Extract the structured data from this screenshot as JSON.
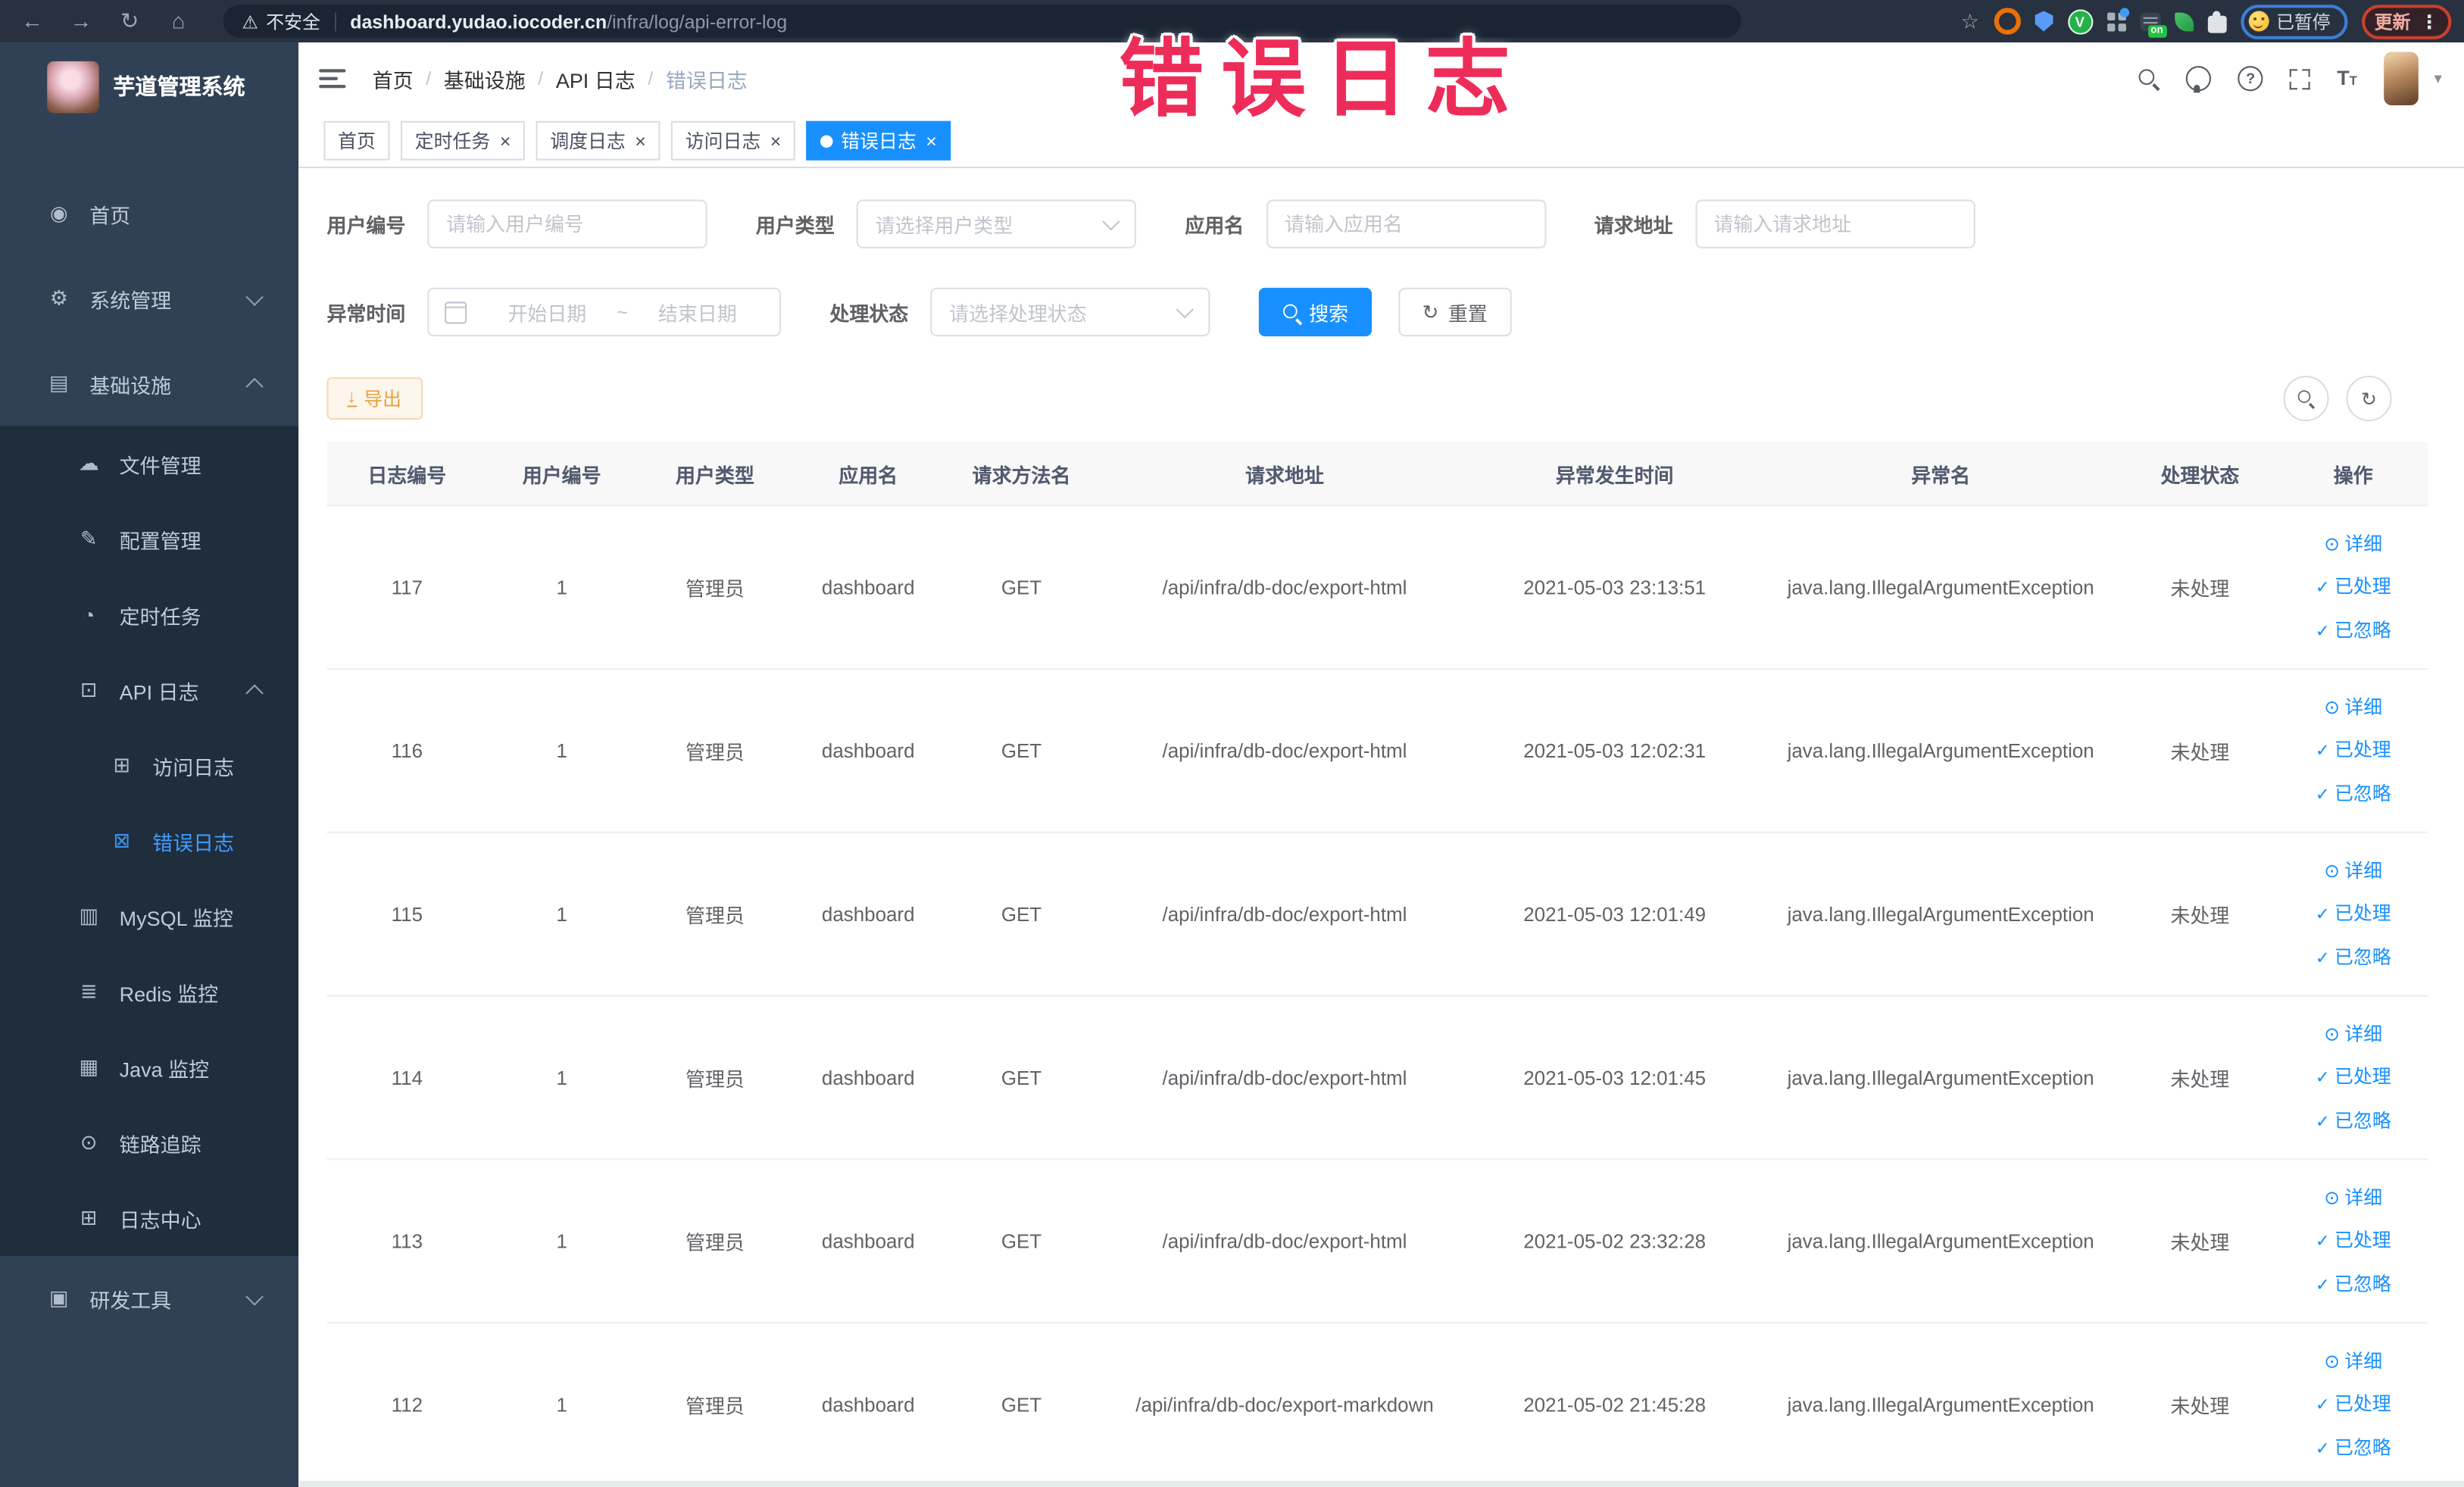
{
  "browser": {
    "security_label": "不安全",
    "url_host": "dashboard.yudao.iocoder.cn",
    "url_path": "/infra/log/api-error-log",
    "paused_label": "已暂停",
    "update_label": "更新"
  },
  "annotation": {
    "text": "错误日志",
    "color": "#ee2c5a"
  },
  "sidebar": {
    "logo_title": "芋道管理系统",
    "items": [
      {
        "id": "home",
        "label": "首页",
        "icon": "dashboard-icon",
        "level": 1
      },
      {
        "id": "system",
        "label": "系统管理",
        "icon": "gear-icon",
        "level": 1,
        "chevron": "down"
      },
      {
        "id": "infra",
        "label": "基础设施",
        "icon": "infra-icon",
        "level": 1,
        "chevron": "up"
      },
      {
        "id": "file",
        "label": "文件管理",
        "icon": "cloud-icon",
        "level": 2
      },
      {
        "id": "config",
        "label": "配置管理",
        "icon": "edit-icon",
        "level": 2
      },
      {
        "id": "job",
        "label": "定时任务",
        "icon": "timer-icon",
        "level": 2
      },
      {
        "id": "api-log",
        "label": "API 日志",
        "icon": "api-log-icon",
        "level": 2,
        "chevron": "up"
      },
      {
        "id": "access-log",
        "label": "访问日志",
        "icon": "access-log-icon",
        "level": 3
      },
      {
        "id": "error-log",
        "label": "错误日志",
        "icon": "error-log-icon",
        "level": 3,
        "active": true
      },
      {
        "id": "mysql",
        "label": "MySQL 监控",
        "icon": "mysql-icon",
        "level": 2
      },
      {
        "id": "redis",
        "label": "Redis 监控",
        "icon": "redis-icon",
        "level": 2
      },
      {
        "id": "java",
        "label": "Java 监控",
        "icon": "java-icon",
        "level": 2
      },
      {
        "id": "trace",
        "label": "链路追踪",
        "icon": "trace-icon",
        "level": 2
      },
      {
        "id": "log-center",
        "label": "日志中心",
        "icon": "log-center-icon",
        "level": 2
      },
      {
        "id": "dev-tools",
        "label": "研发工具",
        "icon": "devtools-icon",
        "level": 1,
        "chevron": "down"
      }
    ]
  },
  "navbar": {
    "breadcrumb": [
      "首页",
      "基础设施",
      "API 日志",
      "错误日志"
    ],
    "breadcrumb_separator": "/"
  },
  "tabs": [
    {
      "label": "首页",
      "closable": false,
      "active": false
    },
    {
      "label": "定时任务",
      "closable": true,
      "active": false
    },
    {
      "label": "调度日志",
      "closable": true,
      "active": false
    },
    {
      "label": "访问日志",
      "closable": true,
      "active": false
    },
    {
      "label": "错误日志",
      "closable": true,
      "active": true
    }
  ],
  "filters": {
    "user_id": {
      "label": "用户编号",
      "placeholder": "请输入用户编号"
    },
    "user_type": {
      "label": "用户类型",
      "placeholder": "请选择用户类型"
    },
    "app_name": {
      "label": "应用名",
      "placeholder": "请输入应用名"
    },
    "request_url": {
      "label": "请求地址",
      "placeholder": "请输入请求地址"
    },
    "exception_time": {
      "label": "异常时间",
      "start_placeholder": "开始日期",
      "separator": "~",
      "end_placeholder": "结束日期"
    },
    "process_status": {
      "label": "处理状态",
      "placeholder": "请选择处理状态"
    },
    "search_label": "搜索",
    "reset_label": "重置"
  },
  "toolbar": {
    "export_label": "导出"
  },
  "table": {
    "columns": [
      "日志编号",
      "用户编号",
      "用户类型",
      "应用名",
      "请求方法名",
      "请求地址",
      "异常发生时间",
      "异常名",
      "处理状态",
      "操作"
    ],
    "action_labels": [
      "详细",
      "已处理",
      "已忽略"
    ],
    "rows": [
      {
        "id": "117",
        "user_id": "1",
        "user_type": "管理员",
        "app": "dashboard",
        "method": "GET",
        "url": "/api/infra/db-doc/export-html",
        "time": "2021-05-03 23:13:51",
        "exception": "java.lang.IllegalArgumentException",
        "status": "未处理"
      },
      {
        "id": "116",
        "user_id": "1",
        "user_type": "管理员",
        "app": "dashboard",
        "method": "GET",
        "url": "/api/infra/db-doc/export-html",
        "time": "2021-05-03 12:02:31",
        "exception": "java.lang.IllegalArgumentException",
        "status": "未处理"
      },
      {
        "id": "115",
        "user_id": "1",
        "user_type": "管理员",
        "app": "dashboard",
        "method": "GET",
        "url": "/api/infra/db-doc/export-html",
        "time": "2021-05-03 12:01:49",
        "exception": "java.lang.IllegalArgumentException",
        "status": "未处理"
      },
      {
        "id": "114",
        "user_id": "1",
        "user_type": "管理员",
        "app": "dashboard",
        "method": "GET",
        "url": "/api/infra/db-doc/export-html",
        "time": "2021-05-03 12:01:45",
        "exception": "java.lang.IllegalArgumentException",
        "status": "未处理"
      },
      {
        "id": "113",
        "user_id": "1",
        "user_type": "管理员",
        "app": "dashboard",
        "method": "GET",
        "url": "/api/infra/db-doc/export-html",
        "time": "2021-05-02 23:32:28",
        "exception": "java.lang.IllegalArgumentException",
        "status": "未处理"
      },
      {
        "id": "112",
        "user_id": "1",
        "user_type": "管理员",
        "app": "dashboard",
        "method": "GET",
        "url": "/api/infra/db-doc/export-markdown",
        "time": "2021-05-02 21:45:28",
        "exception": "java.lang.IllegalArgumentException",
        "status": "未处理"
      }
    ]
  },
  "colors": {
    "primary": "#1890ff",
    "sidebar_bg": "#304156",
    "submenu_bg": "#1f2d3d",
    "active_menu": "#409eff",
    "warning": "#e6a23c"
  }
}
